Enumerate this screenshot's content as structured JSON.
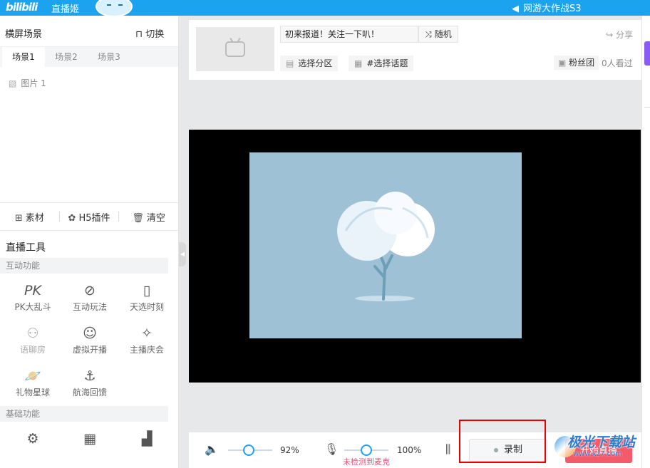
{
  "topbar": {
    "logo": "bilibili",
    "app_name": "直播姬",
    "announcement": "网游大作战S3"
  },
  "scene_panel": {
    "title": "横屏场景",
    "switch_label": "切换",
    "tabs": [
      {
        "label": "场景1"
      },
      {
        "label": "场景2"
      },
      {
        "label": "场景3"
      }
    ],
    "sources": [
      {
        "label": "图片 1"
      }
    ],
    "actions": [
      {
        "label": "素材"
      },
      {
        "label": "H5插件"
      },
      {
        "label": "清空"
      }
    ]
  },
  "tools": {
    "title": "直播工具",
    "interactive_label": "互动功能",
    "interactive": [
      {
        "label": "PK大乱斗"
      },
      {
        "label": "互动玩法"
      },
      {
        "label": "天选时刻"
      },
      {
        "label": "语聊房"
      },
      {
        "label": "虚拟开播"
      },
      {
        "label": "主播庆会"
      },
      {
        "label": "礼物星球"
      },
      {
        "label": "航海回馈"
      }
    ],
    "basic_label": "基础功能"
  },
  "stream_info": {
    "title_value": "初来报道！关注一下叭！",
    "random_label": "随机",
    "share_label": "分享",
    "category_label": "选择分区",
    "topic_label": "#选择话题",
    "fans_label": "粉丝团",
    "viewers_text": "0人看过"
  },
  "controls": {
    "volume_percent": "92%",
    "volume_value": 0.46,
    "mic_percent": "100%",
    "mic_value": 0.5,
    "mic_warning": "未检测到麦克",
    "record_label": "录制",
    "start_live_label": "开始直播"
  },
  "watermark": {
    "text": "极光下载站",
    "url": "www.xz7.com"
  },
  "colors": {
    "accent": "#1ca3f0",
    "live_button": "#f45a6a",
    "highlight": "#e00000",
    "warning": "#e0557a"
  }
}
